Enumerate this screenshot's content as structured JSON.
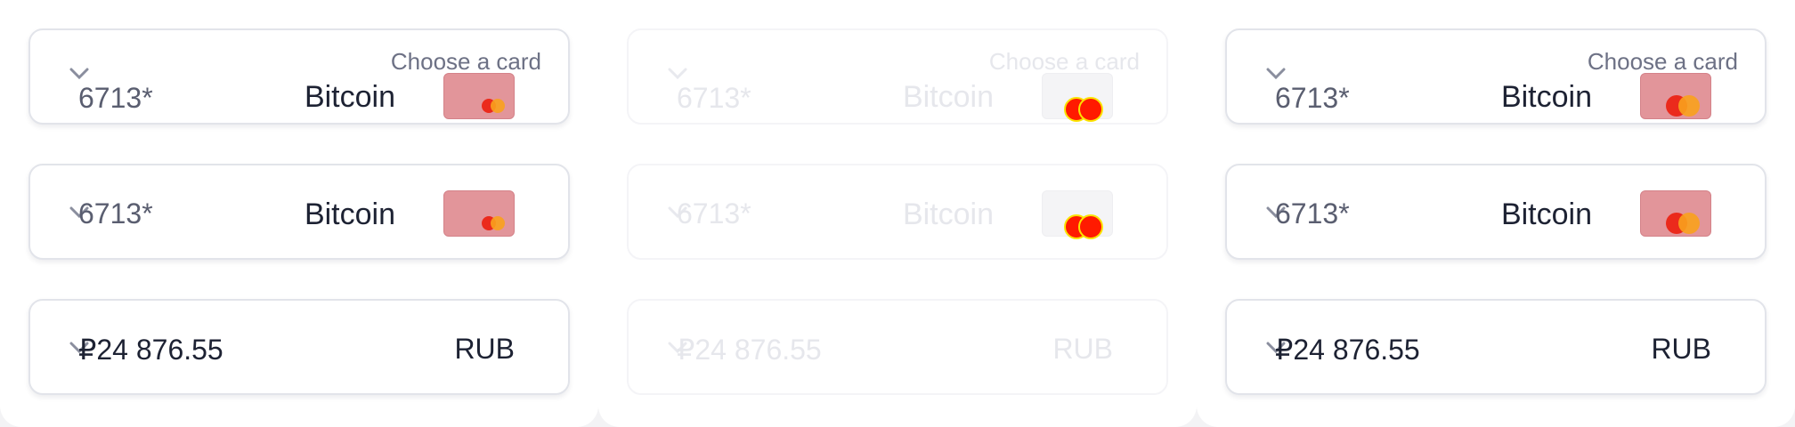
{
  "card_selector": {
    "choose_label": "Choose a card",
    "card_number": "6713*",
    "currency_name": "Bitcoin",
    "icons": [
      "chevron-down-icon",
      "mastercard-icon"
    ]
  },
  "amount_field": {
    "amount": "₽24 876.55",
    "currency_code": "RUB"
  },
  "colors": {
    "card_thumb": "#e2959a",
    "mastercard_red": "#eb2a1c",
    "mastercard_orange": "#f9a11d",
    "text_dark": "#1d2233",
    "text_muted": "#6d7185"
  }
}
